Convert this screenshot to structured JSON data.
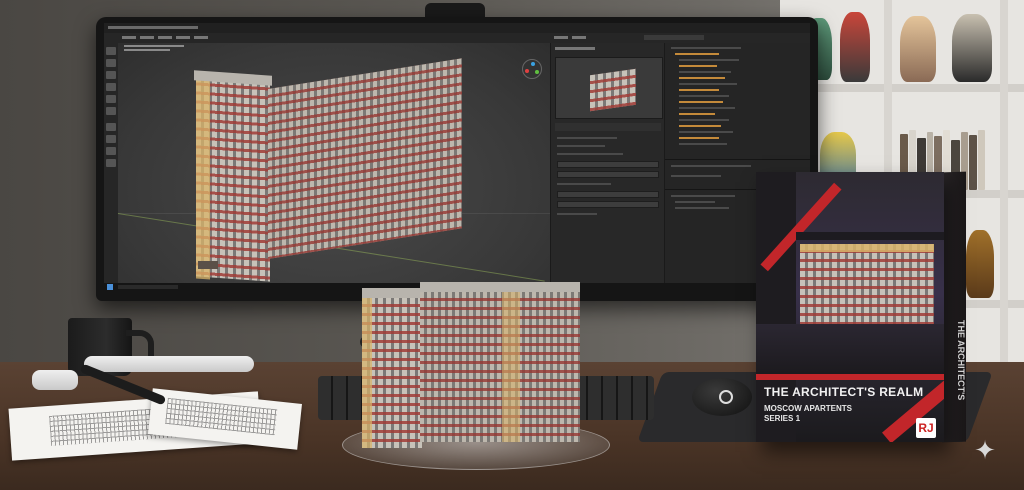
{
  "product_box": {
    "title": "THE ARCHITECT'S REALM",
    "subtitle_line1": "MOSCOW APARTENTS",
    "subtitle_line2": "SERIES 1",
    "spine_text": "THE ARCHITECT'S",
    "logo_text": "RJ"
  },
  "icons": {
    "sparkle": "sparkle-icon",
    "windows_start": "windows-logo-icon",
    "mouse_logo": "gaming-mouse-logo-icon"
  },
  "colors": {
    "facade_base": "#c7c2b9",
    "facade_accent": "#d9b46a",
    "balcony_red": "#a03c37",
    "box_red": "#c2262a",
    "editor_bg": "#2d2d2d",
    "outliner_highlight": "#c48a3a"
  }
}
